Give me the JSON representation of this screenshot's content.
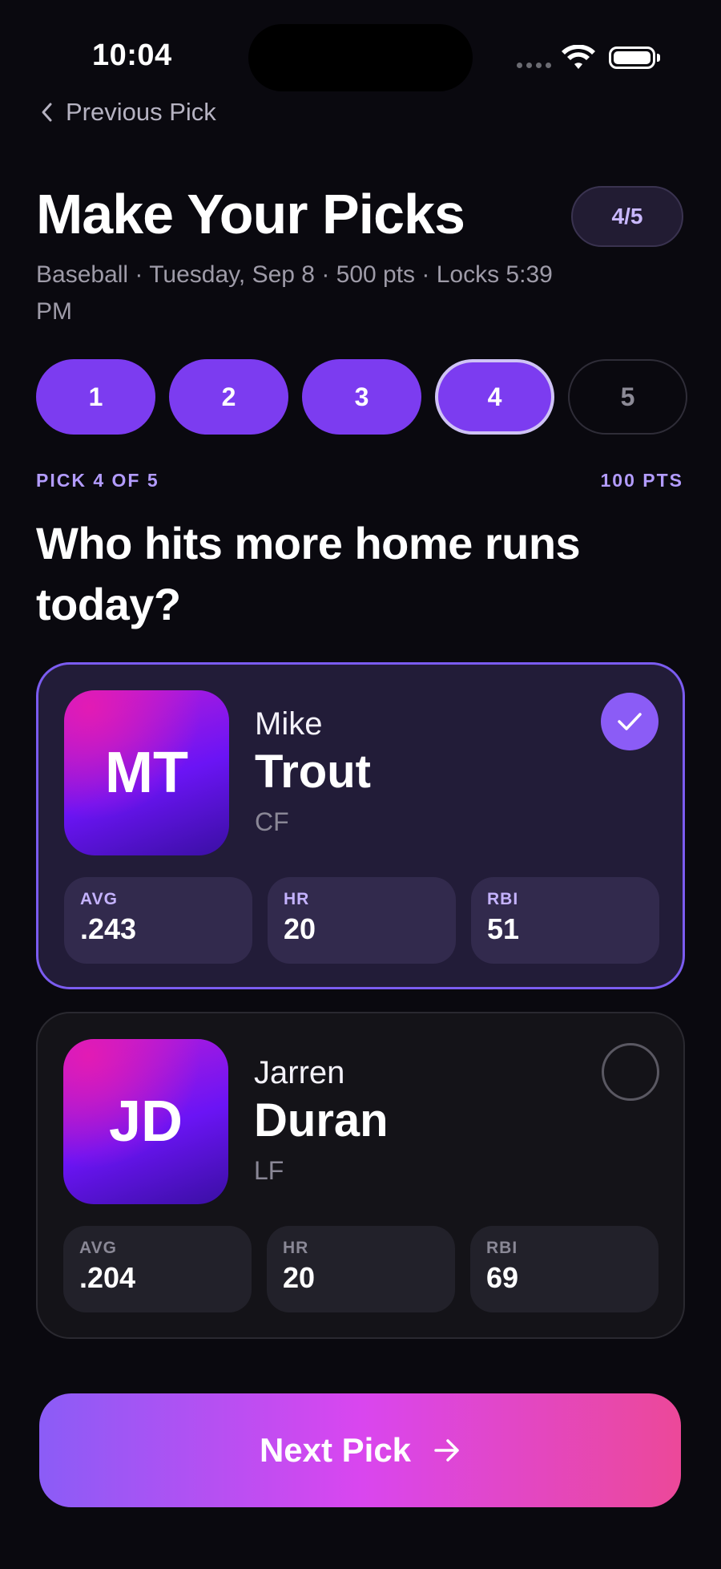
{
  "status_bar": {
    "time": "10:04"
  },
  "nav": {
    "back_label": "Previous Pick"
  },
  "header": {
    "title": "Make Your Picks",
    "progress_badge": "4/5",
    "subtitle": "Baseball · Tuesday, Sep 8 · 500 pts · Locks 5:39 PM"
  },
  "steps": [
    {
      "label": "1",
      "state": "done"
    },
    {
      "label": "2",
      "state": "done"
    },
    {
      "label": "3",
      "state": "done"
    },
    {
      "label": "4",
      "state": "current"
    },
    {
      "label": "5",
      "state": "todo"
    }
  ],
  "pick": {
    "label": "PICK 4 OF 5",
    "points": "100 PTS",
    "question": "Who hits more home runs today?"
  },
  "players": [
    {
      "initials": "MT",
      "first_name": "Mike",
      "last_name": "Trout",
      "position": "CF",
      "selected": true,
      "stats": [
        {
          "label": "AVG",
          "value": ".243"
        },
        {
          "label": "HR",
          "value": "20"
        },
        {
          "label": "RBI",
          "value": "51"
        }
      ]
    },
    {
      "initials": "JD",
      "first_name": "Jarren",
      "last_name": "Duran",
      "position": "LF",
      "selected": false,
      "stats": [
        {
          "label": "AVG",
          "value": ".204"
        },
        {
          "label": "HR",
          "value": "20"
        },
        {
          "label": "RBI",
          "value": "69"
        }
      ]
    }
  ],
  "footer": {
    "next_label": "Next Pick"
  },
  "icons": {
    "back": "chevron-left-icon",
    "check": "checkmark-icon",
    "next": "arrow-right-icon",
    "wifi": "wifi-icon",
    "battery": "battery-icon",
    "signal": "signal-icon"
  },
  "colors": {
    "accent": "#7c3cf0",
    "accent_light": "#b39cff",
    "background": "#0a090f",
    "cta_gradient": [
      "#8b5cf6",
      "#d946ef",
      "#ec4899"
    ]
  }
}
